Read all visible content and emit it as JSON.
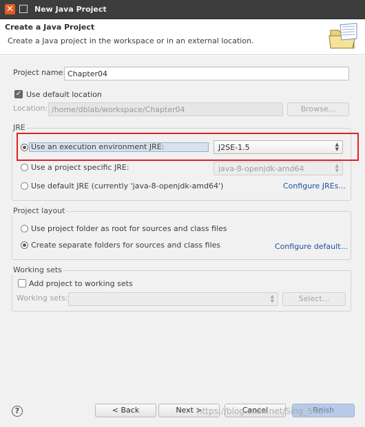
{
  "window": {
    "title": "New Java Project"
  },
  "header": {
    "title": "Create a Java Project",
    "description": "Create a Java project in the workspace or in an external location.",
    "icon": "folder-wizard-icon"
  },
  "project": {
    "name_label": "Project name:",
    "name_value": "Chapter04",
    "use_default_location_label": "Use default location",
    "use_default_location_checked": true,
    "location_label": "Location:",
    "location_value": "/home/dblab/workspace/Chapter04",
    "browse_label": "Browse..."
  },
  "jre": {
    "group_label": "JRE",
    "option_execution_env_label": "Use an execution environment JRE:",
    "option_execution_env_selected": true,
    "execution_env_value": "J2SE-1.5",
    "option_project_specific_label": "Use a project specific JRE:",
    "project_specific_value": "java-8-openjdk-amd64",
    "option_default_label": "Use default JRE (currently 'java-8-openjdk-amd64')",
    "configure_link": "Configure JREs..."
  },
  "layout": {
    "group_label": "Project layout",
    "option_root_label": "Use project folder as root for sources and class files",
    "option_separate_label": "Create separate folders for sources and class files",
    "option_separate_selected": true,
    "configure_link": "Configure default..."
  },
  "working_sets": {
    "group_label": "Working sets",
    "add_label": "Add project to working sets",
    "add_checked": false,
    "working_sets_label": "Working sets:",
    "select_label": "Select..."
  },
  "footer": {
    "help_label": "?",
    "back_label": "< Back",
    "next_label": "Next >",
    "cancel_label": "Cancel",
    "finish_label": "Finish"
  },
  "watermark": "https://blog.csdn.net/Sing_546",
  "colors": {
    "titlebar": "#3d3d3d",
    "close_button": "#e15b20",
    "highlight_box": "#e02020",
    "link": "#1f4e9e"
  }
}
